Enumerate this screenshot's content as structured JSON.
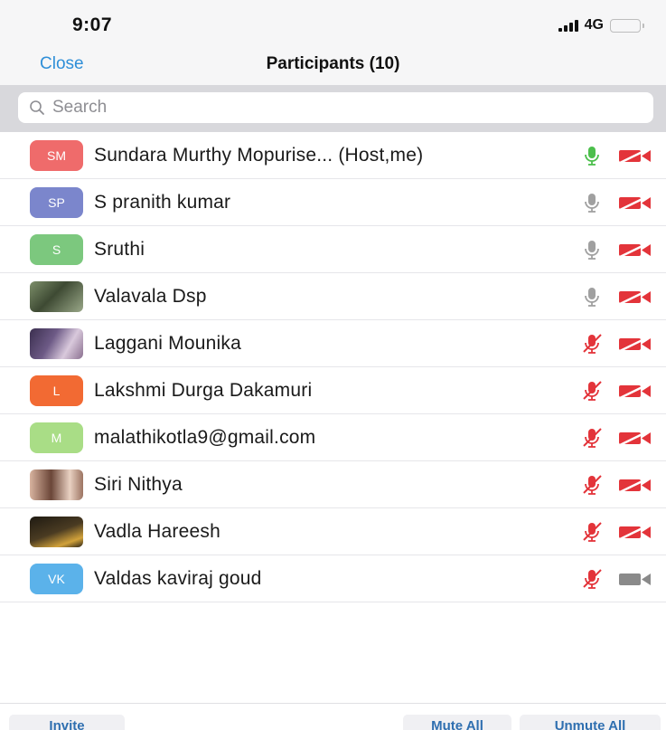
{
  "status_bar": {
    "time": "9:07",
    "network": "4G"
  },
  "nav": {
    "close_label": "Close",
    "title": "Participants (10)"
  },
  "search": {
    "placeholder": "Search"
  },
  "participants": [
    {
      "initials": "SM",
      "name": "Sundara Murthy Mopurise... (Host,me)",
      "avatar_color": "#ef6b6b",
      "mic": "unmuted-active",
      "video": "off"
    },
    {
      "initials": "SP",
      "name": "S pranith kumar",
      "avatar_color": "#7b86cc",
      "mic": "unmuted",
      "video": "off"
    },
    {
      "initials": "S",
      "name": "Sruthi",
      "avatar_color": "#7cc87e",
      "mic": "unmuted",
      "video": "off"
    },
    {
      "initials": "",
      "name": "Valavala Dsp",
      "avatar_color": "#5a6b4a",
      "mic": "unmuted",
      "video": "off"
    },
    {
      "initials": "",
      "name": "Laggani Mounika",
      "avatar_color": "#5c4e6e",
      "mic": "muted",
      "video": "off"
    },
    {
      "initials": "L",
      "name": "Lakshmi Durga Dakamuri",
      "avatar_color": "#f26a33",
      "mic": "muted",
      "video": "off"
    },
    {
      "initials": "M",
      "name": "malathikotla9@gmail.com",
      "avatar_color": "#a9dd86",
      "mic": "muted",
      "video": "off"
    },
    {
      "initials": "",
      "name": "Siri Nithya",
      "avatar_color": "#b08370",
      "mic": "muted",
      "video": "off"
    },
    {
      "initials": "",
      "name": "Vadla Hareesh",
      "avatar_color": "#2c2418",
      "mic": "muted",
      "video": "off"
    },
    {
      "initials": "VK",
      "name": "Valdas kaviraj goud",
      "avatar_color": "#5bb2ea",
      "mic": "muted",
      "video": "on"
    }
  ],
  "footer": {
    "invite_label": "Invite",
    "mute_all_label": "Mute All",
    "unmute_all_label": "Unmute All"
  },
  "colors": {
    "accent": "#2f8fd8",
    "mic_active": "#4cbf4c",
    "mic_idle": "#a0a0a0",
    "muted_red": "#e3343a"
  }
}
